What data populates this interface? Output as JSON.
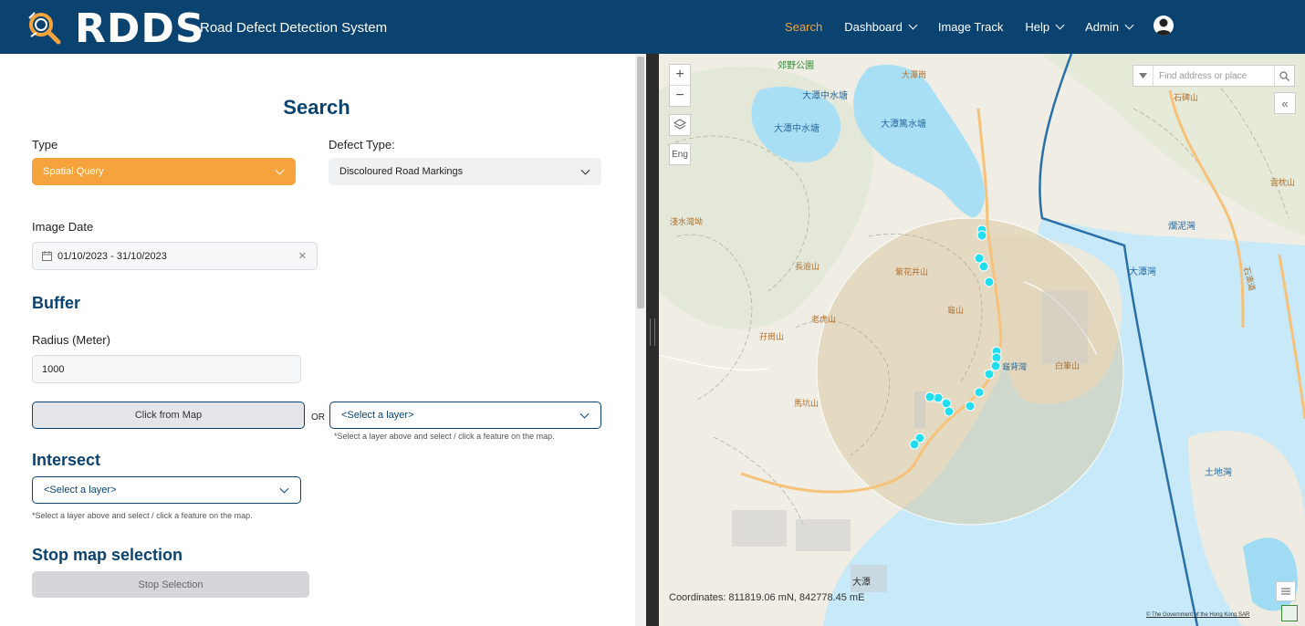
{
  "header": {
    "brand": "RDDS",
    "subtitle": "Road Defect Detection System",
    "nav": [
      {
        "label": "Search",
        "active": true,
        "dropdown": false
      },
      {
        "label": "Dashboard",
        "active": false,
        "dropdown": true
      },
      {
        "label": "Image Track",
        "active": false,
        "dropdown": false
      },
      {
        "label": "Help",
        "active": false,
        "dropdown": true
      },
      {
        "label": "Admin",
        "active": false,
        "dropdown": true
      }
    ]
  },
  "search": {
    "title": "Search",
    "type_label": "Type",
    "type_value": "Spatial Query",
    "defect_label": "Defect Type:",
    "defect_value": "Discoloured Road Markings",
    "image_date_label": "Image Date",
    "image_date_value": "01/10/2023 - 31/10/2023",
    "buffer_title": "Buffer",
    "radius_label": "Radius (Meter)",
    "radius_value": "1000",
    "click_from_map": "Click from Map",
    "or_label": "OR",
    "select_layer": "<Select a layer>",
    "select_hint": "*Select a layer above and select / click a feature on the map.",
    "intersect_title": "Intersect",
    "intersect_select": "<Select a layer>",
    "intersect_hint": "*Select a layer above and select / click a feature on the map.",
    "stop_title": "Stop map selection",
    "stop_button": "Stop Selection"
  },
  "map": {
    "search_placeholder": "Find address or place",
    "lang_button": "Eng",
    "coordinates": "Coordinates: 811819.06 mN, 842778.45 mE",
    "attribution": "© The Government of the Hong Kong SAR",
    "labels": [
      {
        "text": "郊野公園",
        "color": "#3a8a3a"
      },
      {
        "text": "大潭中水塘",
        "color": "#2a6aa0"
      },
      {
        "text": "大潭中水塘",
        "color": "#2a6aa0"
      },
      {
        "text": "大潭篤水塘",
        "color": "#2a6aa0"
      },
      {
        "text": "大潭崗",
        "color": "#b07030"
      },
      {
        "text": "石碑山",
        "color": "#b07030"
      },
      {
        "text": "淺水灣坳",
        "color": "#b07030"
      },
      {
        "text": "長逾山",
        "color": "#b07030"
      },
      {
        "text": "紫花井山",
        "color": "#b07030"
      },
      {
        "text": "龜山",
        "color": "#b07030"
      },
      {
        "text": "老虎山",
        "color": "#b07030"
      },
      {
        "text": "孖崗山",
        "color": "#b07030"
      },
      {
        "text": "龜背灣",
        "color": "#2a6aa0"
      },
      {
        "text": "白筆山",
        "color": "#b07030"
      },
      {
        "text": "馬坑山",
        "color": "#b07030"
      },
      {
        "text": "大潭灣",
        "color": "#2a6aa0"
      },
      {
        "text": "爛泥灣",
        "color": "#2a6aa0"
      },
      {
        "text": "土地灣",
        "color": "#2a6aa0"
      },
      {
        "text": "大潭",
        "color": "#333333"
      },
      {
        "text": "雲枕山",
        "color": "#b07030"
      },
      {
        "text": "石澳道",
        "color": "#b07030"
      }
    ]
  },
  "colors": {
    "header_bg": "#0a4270",
    "accent": "#f5a33c",
    "marker": "#22dff0"
  }
}
